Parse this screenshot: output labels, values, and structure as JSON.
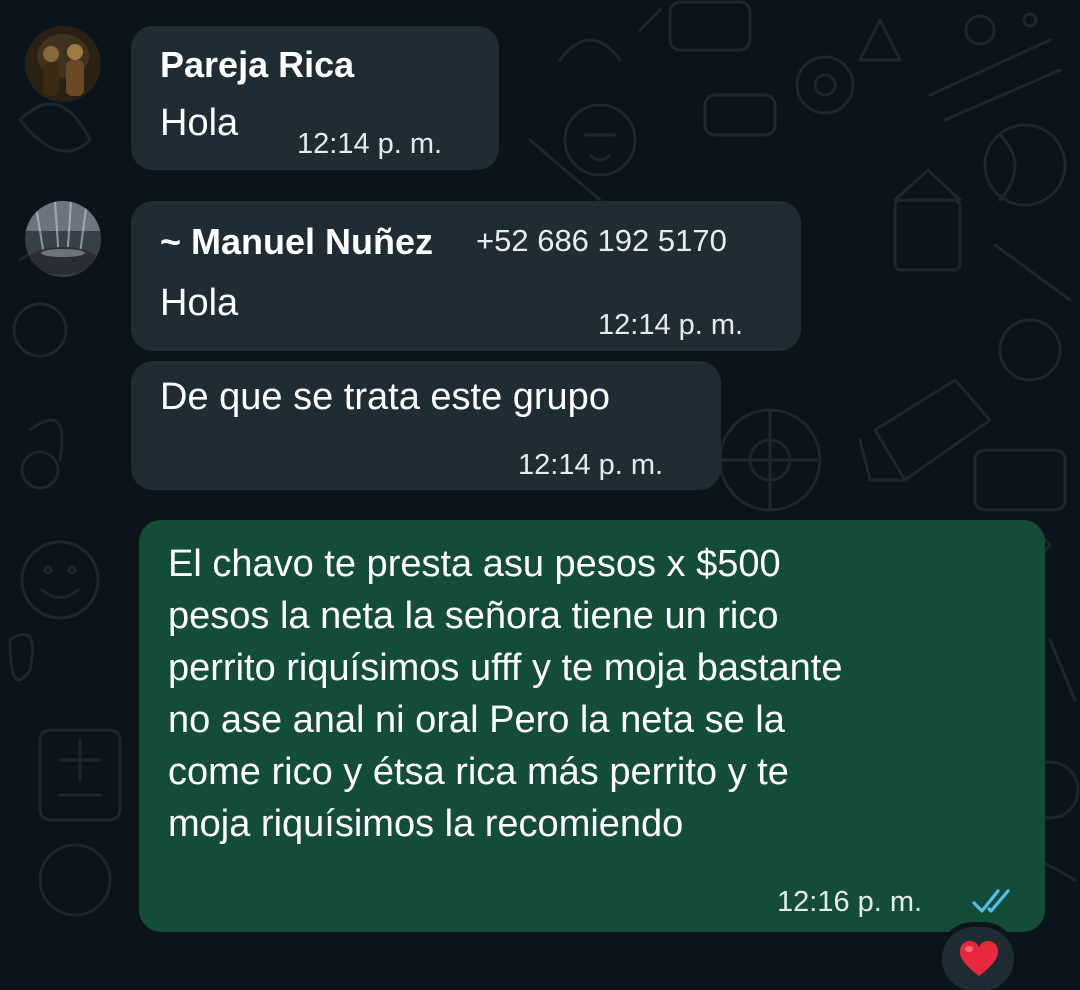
{
  "messages": [
    {
      "sender": "Pareja Rica",
      "text": "Hola",
      "time": "12:14 p. m."
    },
    {
      "sender": "~ Manuel Nuñez",
      "phone": "+52 686 192 5170",
      "text": "Hola",
      "time": "12:14 p. m."
    },
    {
      "text": "De que se trata este grupo",
      "time": "12:14 p. m."
    },
    {
      "lines": [
        "El chavo te presta asu pesos x $500",
        "pesos la neta la señora tiene un rico",
        "perrito riquísimos ufff y te moja bastante",
        "no ase anal ni oral Pero la neta se la",
        "come rico y étsa rica más perrito y te",
        "moja riquísimos la recomiendo"
      ],
      "time": "12:16 p. m.",
      "status_icon": "double-check-read-icon",
      "reaction": "❤️",
      "reaction_icon": "red-heart-icon"
    }
  ],
  "colors": {
    "background": "#0b141a",
    "incoming_bubble": "#202c33",
    "outgoing_bubble": "#144d37",
    "read_ticks": "#53bdeb",
    "heart": "#e8283c"
  }
}
